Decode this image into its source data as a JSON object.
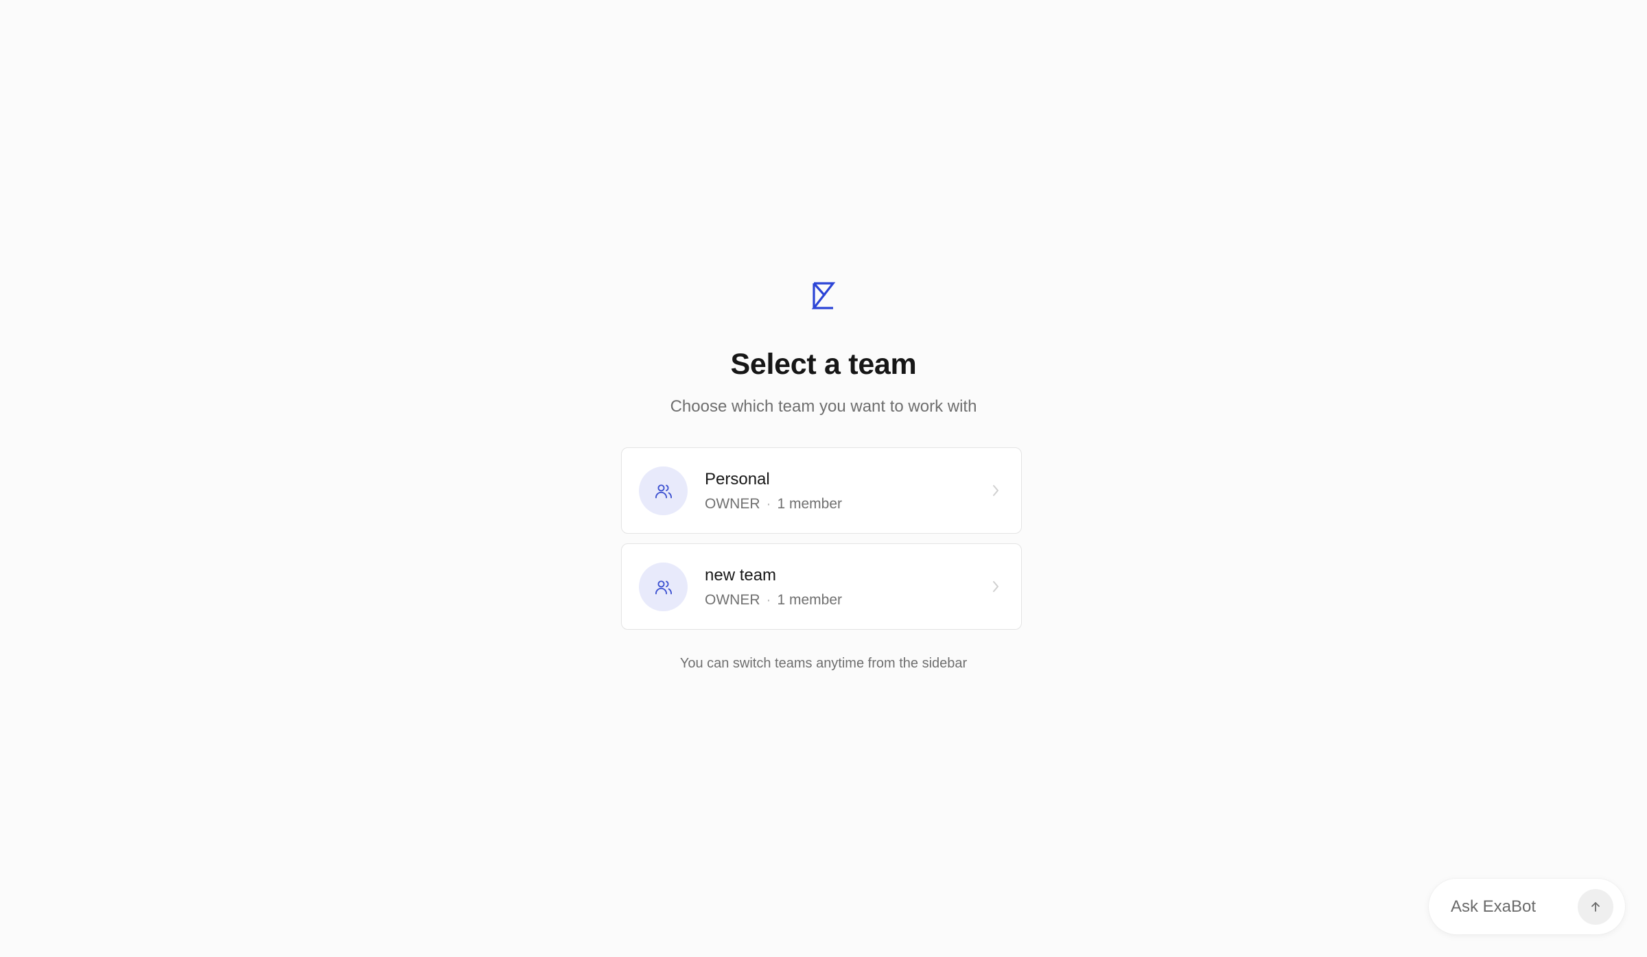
{
  "brand": {
    "logo_icon": "hourglass-logo-icon",
    "accent_color": "#2b44d6"
  },
  "header": {
    "title": "Select a team",
    "subtitle": "Choose which team you want to work with"
  },
  "teams": [
    {
      "name": "Personal",
      "role": "OWNER",
      "separator": "·",
      "members": "1 member",
      "icon": "users-icon"
    },
    {
      "name": "new team",
      "role": "OWNER",
      "separator": "·",
      "members": "1 member",
      "icon": "users-icon"
    }
  ],
  "footer": {
    "note": "You can switch teams anytime from the sidebar"
  },
  "assistant": {
    "placeholder": "Ask ExaBot",
    "send_icon": "arrow-up-icon"
  }
}
